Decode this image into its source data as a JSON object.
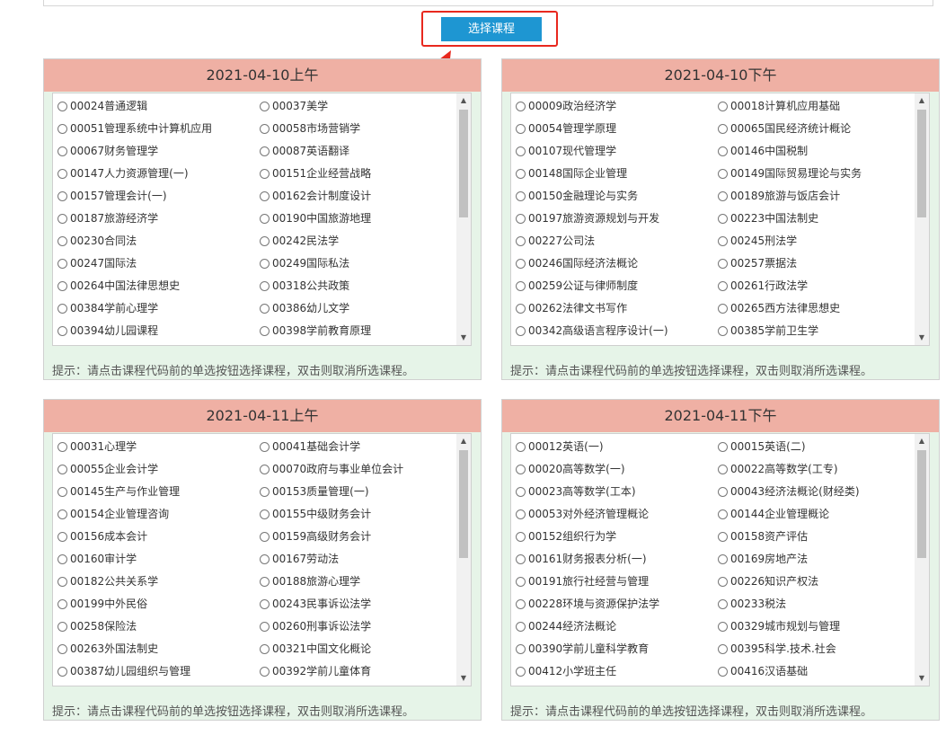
{
  "select_button": {
    "label": "选择课程"
  },
  "panels": [
    {
      "title": "2021-04-10上午",
      "courses": [
        "00024普通逻辑",
        "00037美学",
        "00051管理系统中计算机应用",
        "00058市场营销学",
        "00067财务管理学",
        "00087英语翻译",
        "00147人力资源管理(一)",
        "00151企业经营战略",
        "00157管理会计(一)",
        "00162会计制度设计",
        "00187旅游经济学",
        "00190中国旅游地理",
        "00230合同法",
        "00242民法学",
        "00247国际法",
        "00249国际私法",
        "00264中国法律思想史",
        "00318公共政策",
        "00384学前心理学",
        "00386幼儿文学",
        "00394幼儿园课程",
        "00398学前教育原理"
      ],
      "hint": "提示：请点击课程代码前的单选按钮选择课程，双击则取消所选课程。"
    },
    {
      "title": "2021-04-10下午",
      "courses": [
        "00009政治经济学",
        "00018计算机应用基础",
        "00054管理学原理",
        "00065国民经济统计概论",
        "00107现代管理学",
        "00146中国税制",
        "00148国际企业管理",
        "00149国际贸易理论与实务",
        "00150金融理论与实务",
        "00189旅游与饭店会计",
        "00197旅游资源规划与开发",
        "00223中国法制史",
        "00227公司法",
        "00245刑法学",
        "00246国际经济法概论",
        "00257票据法",
        "00259公证与律师制度",
        "00261行政法学",
        "00262法律文书写作",
        "00265西方法律思想史",
        "00342高级语言程序设计(一)",
        "00385学前卫生学"
      ],
      "hint": "提示：请点击课程代码前的单选按钮选择课程，双击则取消所选课程。"
    },
    {
      "title": "2021-04-11上午",
      "courses": [
        "00031心理学",
        "00041基础会计学",
        "00055企业会计学",
        "00070政府与事业单位会计",
        "00145生产与作业管理",
        "00153质量管理(一)",
        "00154企业管理咨询",
        "00155中级财务会计",
        "00156成本会计",
        "00159高级财务会计",
        "00160审计学",
        "00167劳动法",
        "00182公共关系学",
        "00188旅游心理学",
        "00199中外民俗",
        "00243民事诉讼法学",
        "00258保险法",
        "00260刑事诉讼法学",
        "00263外国法制史",
        "00321中国文化概论",
        "00387幼儿园组织与管理",
        "00392学前儿童体育"
      ],
      "hint": "提示：请点击课程代码前的单选按钮选择课程，双击则取消所选课程。"
    },
    {
      "title": "2021-04-11下午",
      "courses": [
        "00012英语(一)",
        "00015英语(二)",
        "00020高等数学(一)",
        "00022高等数学(工专)",
        "00023高等数学(工本)",
        "00043经济法概论(财经类)",
        "00053对外经济管理概论",
        "00144企业管理概论",
        "00152组织行为学",
        "00158资产评估",
        "00161财务报表分析(一)",
        "00169房地产法",
        "00191旅行社经营与管理",
        "00226知识产权法",
        "00228环境与资源保护法学",
        "00233税法",
        "00244经济法概论",
        "00329城市规划与管理",
        "00390学前儿童科学教育",
        "00395科学.技术.社会",
        "00412小学班主任",
        "00416汉语基础"
      ],
      "hint": "提示：请点击课程代码前的单选按钮选择课程，双击则取消所选课程。"
    }
  ],
  "icons": {
    "scroll_up": "scroll-up-arrow-icon",
    "scroll_down": "scroll-down-arrow-icon",
    "annotation": "red-arrow-icon"
  },
  "colors": {
    "header": "#efb0a4",
    "panel_bg": "#e6f4e8",
    "button": "#1e96d2",
    "highlight": "#e8281e"
  }
}
